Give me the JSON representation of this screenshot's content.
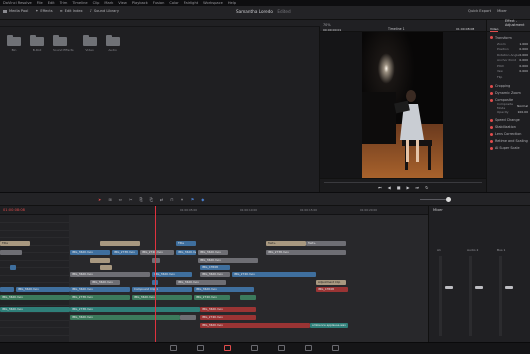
{
  "menu": [
    "DaVinci Resolve",
    "File",
    "Edit",
    "Trim",
    "Timeline",
    "Clip",
    "Mark",
    "View",
    "Playback",
    "Fusion",
    "Color",
    "Fairlight",
    "Workspace",
    "Help"
  ],
  "toolbar": {
    "media_pool": "Media Pool",
    "effects": "Effects",
    "index": "Edit Index",
    "sound_library": "Sound Library",
    "project_title": "Samantha Loredo",
    "edited": "Edited",
    "quick_export": "Quick Export",
    "mixer": "Mixer",
    "meta": "Metadata",
    "inspector": "Inspector"
  },
  "bins": [
    {
      "label": "Bin"
    },
    {
      "label": "B-Roll"
    },
    {
      "label": "Sound Effects"
    },
    {
      "label": "Video"
    },
    {
      "label": "Audio"
    }
  ],
  "viewer": {
    "zoom": "70%",
    "source_tc": "00:00:00:01",
    "timeline_name": "Timeline 1",
    "record_tc": "01:00:08:08"
  },
  "inspector": {
    "tabs": [
      "Video",
      "Audio",
      "Effects",
      "Transition",
      "Image",
      "File"
    ],
    "header": "Effect - Adjustment",
    "transform": "Transform",
    "fields": [
      {
        "k": "Zoom",
        "v": "1.000"
      },
      {
        "k": "Position",
        "v": "0.000"
      },
      {
        "k": "Rotation Angle",
        "v": "0.000"
      },
      {
        "k": "Anchor Point",
        "v": "0.000"
      },
      {
        "k": "Pitch",
        "v": "0.000"
      },
      {
        "k": "Yaw",
        "v": "0.000"
      },
      {
        "k": "Flip",
        "v": ""
      }
    ],
    "sections": [
      "Cropping",
      "Dynamic Zoom",
      "Composite"
    ],
    "composite_mode_label": "Composite Mode",
    "composite_mode": "Normal",
    "opacity_label": "Opacity",
    "opacity": "100.00",
    "more_sections": [
      "Speed Change",
      "Stabilization",
      "Lens Correction",
      "Retime and Scaling",
      "AI Super Scale"
    ]
  },
  "timeline": {
    "timecode": "01:00:08:08",
    "ruler": [
      "01:00:00:00",
      "01:00:05:00",
      "01:00:10:00",
      "01:00:15:00",
      "01:00:20:00"
    ],
    "mixer_title": "Mixer",
    "mixer_channels": [
      "A1",
      "Audio 2",
      "Bus 1"
    ],
    "clips_labels": {
      "title": "Title",
      "compound": "Compound Clip 1",
      "adjustment": "Adjustment Clip",
      "text": "Text+",
      "cs": "IMG_C3508",
      "mov": "IMG_3620.mov",
      "mov2": "IMG_2738.mov",
      "mov3": "IMG_2740.mov",
      "ambience": "ambience applause.wav"
    }
  },
  "pages": [
    "Media",
    "Cut",
    "Edit",
    "Fusion",
    "Color",
    "Fairlight",
    "Deliver"
  ],
  "colors": {
    "accent_red": "#e04c4c",
    "playhead": "#e0323e",
    "clip_blue": "#3f6f9e",
    "clip_green": "#3c7a5c"
  }
}
